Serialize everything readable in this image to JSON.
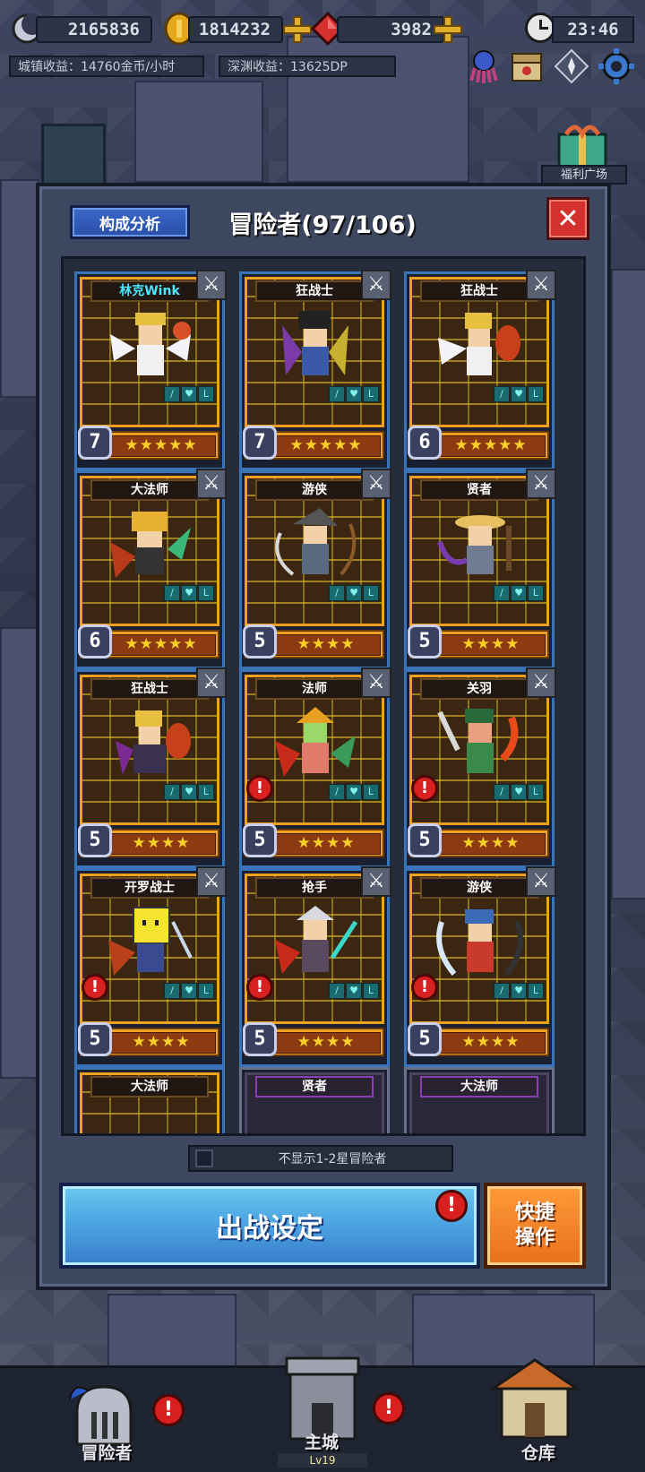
{
  "resources": {
    "moon_value": "2165836",
    "gold_value": "1814232",
    "gem_value": "3982",
    "time": "23:46",
    "town_income": "城镇收益：14760金币/小时",
    "abyss_income": "深渊收益：13625DP"
  },
  "welfare_label": "福利广场",
  "modal": {
    "analysis_button": "构成分析",
    "title": "冒险者(97/106)",
    "close_label": "✕"
  },
  "cards": [
    {
      "name": "林克Wink",
      "level": "7",
      "stars": "★★★★★"
    },
    {
      "name": "狂战士",
      "level": "7",
      "stars": "★★★★★"
    },
    {
      "name": "狂战士",
      "level": "6",
      "stars": "★★★★★"
    },
    {
      "name": "大法师",
      "level": "6",
      "stars": "★★★★★"
    },
    {
      "name": "游侠",
      "level": "5",
      "stars": "★★★★"
    },
    {
      "name": "贤者",
      "level": "5",
      "stars": "★★★★"
    },
    {
      "name": "狂战士",
      "level": "5",
      "stars": "★★★★"
    },
    {
      "name": "法师",
      "level": "5",
      "stars": "★★★★"
    },
    {
      "name": "关羽",
      "level": "5",
      "stars": "★★★★"
    },
    {
      "name": "开罗战士",
      "level": "5",
      "stars": "★★★★"
    },
    {
      "name": "抢手",
      "level": "5",
      "stars": "★★★★"
    },
    {
      "name": "游侠",
      "level": "5",
      "stars": "★★★★"
    },
    {
      "name": "大法师"
    },
    {
      "name": "贤者"
    },
    {
      "name": "大法师"
    }
  ],
  "filter_label": "不显示1-2星冒险者",
  "battle_button": "出战设定",
  "quick_button": "快捷\n操作",
  "alert_mark": "!",
  "nav": {
    "adventurer": "冒险者",
    "main_city": "主城",
    "main_city_level": "Lv19",
    "warehouse": "仓库"
  },
  "colors": {
    "accent_blue": "#3a74b8",
    "card_gold": "#f0a020",
    "alert_red": "#d82020",
    "quick_orange": "#e8701a"
  }
}
